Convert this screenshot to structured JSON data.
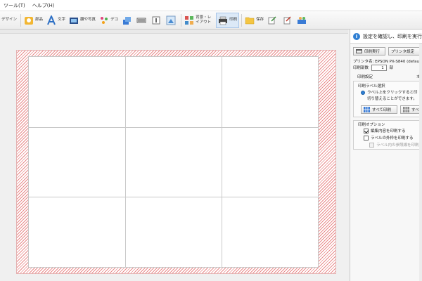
{
  "menu": [
    "ツール(T)",
    "ヘルプ(H)"
  ],
  "toolbar": {
    "items": [
      {
        "label": "デザイン"
      },
      {
        "label": "部品"
      },
      {
        "label": "文字"
      },
      {
        "label": "額や写真"
      },
      {
        "label": "デコ"
      },
      {
        "label": ""
      },
      {
        "label": ""
      },
      {
        "label": ""
      },
      {
        "label": ""
      },
      {
        "label": "背景・レイアウト"
      },
      {
        "label": "印刷"
      },
      {
        "label": "保存"
      },
      {
        "label": ""
      },
      {
        "label": ""
      },
      {
        "label": ""
      }
    ]
  },
  "panel": {
    "header": "設定を確認し、印刷を実行しま",
    "print_button": "印刷実行",
    "printer_settings_button": "プリンタ設定",
    "printer_name_label": "プリンタ名:",
    "printer_name_value": "EPSON PX-S840 (defau",
    "copies_label": "印刷部数",
    "copies_value": "1",
    "copies_unit": "部",
    "print_settings_label": "印刷設定",
    "print_settings_right": "オ",
    "label_select": {
      "title": "印刷ラベル選択",
      "desc_line1": "ラベル上をクリックすると印",
      "desc_line2": "切り替えることができます。",
      "all_print_button": "すべて印刷",
      "all_other_button": "すべ"
    },
    "options": {
      "title": "印刷オプション",
      "opt1": "編集内容を印刷する",
      "opt2": "ラベルの外枠を印刷する",
      "opt3": "ラベル内の参照線を印刷"
    }
  },
  "colors": {
    "accent": "#2f7fd3",
    "paper_hatch": "#e98a8a"
  }
}
